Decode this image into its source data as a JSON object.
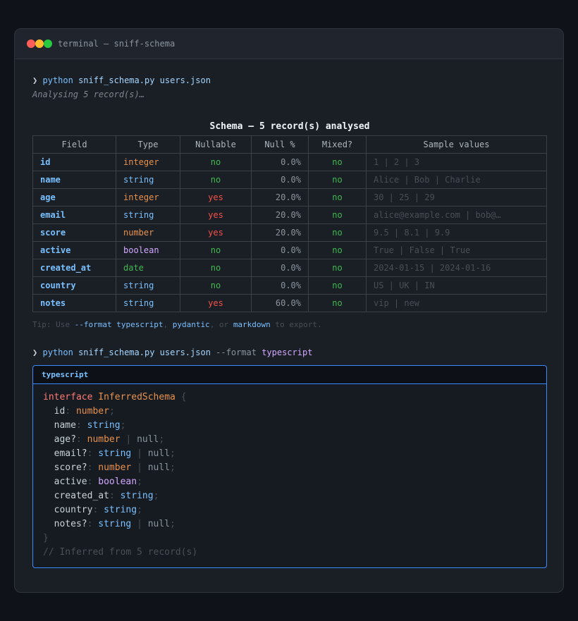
{
  "window": {
    "title": "terminal — sniff-schema"
  },
  "cmd1": {
    "prompt": "❯",
    "program": "python",
    "script": "sniff_schema.py",
    "file": "users.json"
  },
  "status": "Analysing 5 record(s)…",
  "table": {
    "title": "Schema — 5 record(s) analysed",
    "headers": [
      "Field",
      "Type",
      "Nullable",
      "Null %",
      "Mixed?",
      "Sample values"
    ],
    "rows": [
      {
        "field": "id",
        "type": "integer",
        "nullable": "no",
        "null_pct": "0.0%",
        "mixed": "no",
        "samples": "1 | 2 | 3"
      },
      {
        "field": "name",
        "type": "string",
        "nullable": "no",
        "null_pct": "0.0%",
        "mixed": "no",
        "samples": "Alice | Bob | Charlie"
      },
      {
        "field": "age",
        "type": "integer",
        "nullable": "yes",
        "null_pct": "20.0%",
        "mixed": "no",
        "samples": "30 | 25 | 29"
      },
      {
        "field": "email",
        "type": "string",
        "nullable": "yes",
        "null_pct": "20.0%",
        "mixed": "no",
        "samples": "alice@example.com | bob@…"
      },
      {
        "field": "score",
        "type": "number",
        "nullable": "yes",
        "null_pct": "20.0%",
        "mixed": "no",
        "samples": "9.5 | 8.1 | 9.9"
      },
      {
        "field": "active",
        "type": "boolean",
        "nullable": "no",
        "null_pct": "0.0%",
        "mixed": "no",
        "samples": "True | False | True"
      },
      {
        "field": "created_at",
        "type": "date",
        "nullable": "no",
        "null_pct": "0.0%",
        "mixed": "no",
        "samples": "2024-01-15 | 2024-01-16"
      },
      {
        "field": "country",
        "type": "string",
        "nullable": "no",
        "null_pct": "0.0%",
        "mixed": "no",
        "samples": "US | UK | IN"
      },
      {
        "field": "notes",
        "type": "string",
        "nullable": "yes",
        "null_pct": "60.0%",
        "mixed": "no",
        "samples": "vip | new"
      }
    ]
  },
  "tip": {
    "prefix": "Tip: Use ",
    "opt1": "--format typescript",
    "sep1": ", ",
    "opt2": "pydantic",
    "sep2": ", or ",
    "opt3": "markdown",
    "suffix": " to export."
  },
  "cmd2": {
    "prompt": "❯",
    "program": "python",
    "script": "sniff_schema.py",
    "file": "users.json",
    "flag": "--format",
    "value": "typescript"
  },
  "codebox": {
    "label": "typescript",
    "interface_kw": "interface",
    "interface_name": "InferredSchema",
    "fields": [
      {
        "name": "id",
        "opt": "",
        "type": "number",
        "null": ""
      },
      {
        "name": "name",
        "opt": "",
        "type": "string",
        "null": ""
      },
      {
        "name": "age",
        "opt": "?",
        "type": "number",
        "null": "null"
      },
      {
        "name": "email",
        "opt": "?",
        "type": "string",
        "null": "null"
      },
      {
        "name": "score",
        "opt": "?",
        "type": "number",
        "null": "null"
      },
      {
        "name": "active",
        "opt": "",
        "type": "boolean",
        "null": ""
      },
      {
        "name": "created_at",
        "opt": "",
        "type": "string",
        "null": ""
      },
      {
        "name": "country",
        "opt": "",
        "type": "string",
        "null": ""
      },
      {
        "name": "notes",
        "opt": "?",
        "type": "string",
        "null": "null"
      }
    ],
    "comment": "// Inferred from 5 record(s)"
  }
}
